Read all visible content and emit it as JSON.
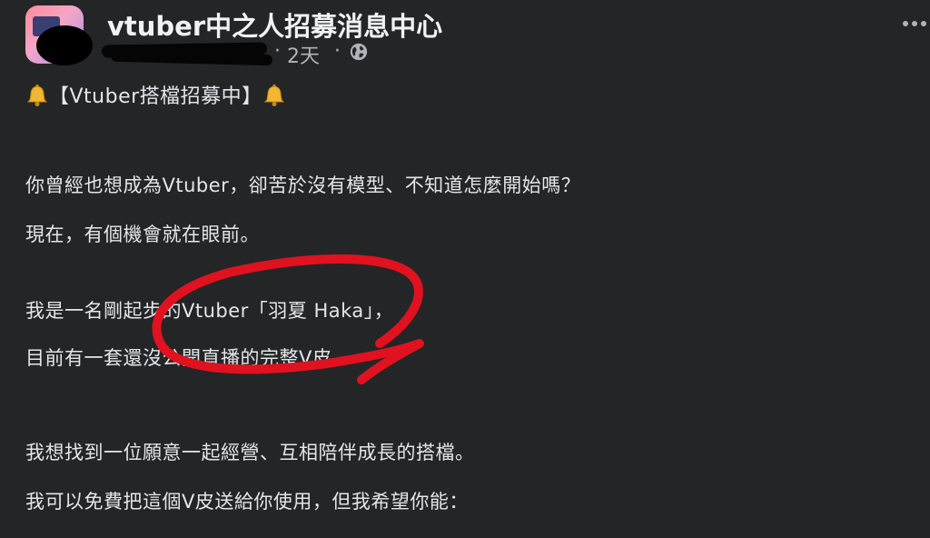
{
  "post": {
    "group_name": "vtuber中之人招募消息中心",
    "time": "2天",
    "separator": "·",
    "headline": "【Vtuber搭檔招募中】",
    "lines": [
      "你曾經也想成為Vtuber，卻苦於沒有模型、不知道怎麼開始嗎？",
      "現在，有個機會就在眼前。",
      "我是一名剛起步的Vtuber「羽夏 Haka」，",
      "目前有一套還沒公開直播的完整V皮，",
      "我想找到一位願意一起經營、互相陪伴成長的搭檔。",
      "我可以免費把這個V皮送給你使用，但我希望你能："
    ]
  },
  "colors": {
    "background": "#242526",
    "text": "#e4e6eb",
    "secondary_text": "#b0b3b8",
    "circle_annotation": "#e0121f",
    "redaction": "#050505"
  },
  "icons": {
    "privacy": "globe-icon",
    "menu": "more-options-icon",
    "headline_emoji": "bell-icon"
  }
}
